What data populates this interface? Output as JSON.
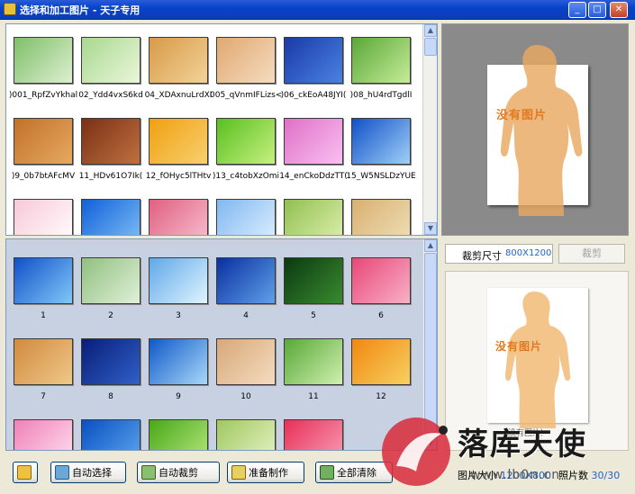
{
  "window": {
    "title": "选择和加工图片 - 天子专用",
    "buttons": [
      "minimize",
      "maximize",
      "close"
    ]
  },
  "source_list": {
    "items": [
      {
        "caption": ")001_RpfZvYkhal",
        "colors": [
          "#7FBF6A",
          "#DDEFD0"
        ]
      },
      {
        "caption": "02_Ydd4vxS6kd",
        "colors": [
          "#A8D890",
          "#EAF6DA"
        ]
      },
      {
        "caption": "04_XDAxnuLrdXI",
        "colors": [
          "#D89A48",
          "#F2D298"
        ]
      },
      {
        "caption": "005_qVnmIFLizs<",
        "colors": [
          "#E0A870",
          "#F5DCC0"
        ]
      },
      {
        "caption": ")06_ckEoA48JYI(",
        "colors": [
          "#1A3AA8",
          "#4A82E0"
        ]
      },
      {
        "caption": ")08_hU4rdTgdlI",
        "colors": [
          "#5AA838",
          "#C6EC98"
        ]
      },
      {
        "caption": ")9_0b7btAFcMV",
        "colors": [
          "#C0722A",
          "#E8A860"
        ]
      },
      {
        "caption": "11_HDv61O7Ik(",
        "colors": [
          "#7A3014",
          "#C07040"
        ]
      },
      {
        "caption": "12_fOHyc5lTHtv",
        "colors": [
          "#F0A010",
          "#F8D070"
        ]
      },
      {
        "caption": ")13_c4tobXzOmi",
        "colors": [
          "#58C020",
          "#C8F080"
        ]
      },
      {
        "caption": "14_enCkoDdzTT(",
        "colors": [
          "#E070C8",
          "#F8C0F0"
        ]
      },
      {
        "caption": "15_W5NSLDzYUE",
        "colors": [
          "#1050C8",
          "#A0D0F8"
        ]
      },
      {
        "caption": "",
        "colors": [
          "#F8C8D8",
          "#FFFFFF"
        ]
      },
      {
        "caption": "",
        "colors": [
          "#1060D8",
          "#80C0F8"
        ]
      },
      {
        "caption": "",
        "colors": [
          "#E06080",
          "#F8C0D0"
        ]
      },
      {
        "caption": "",
        "colors": [
          "#80B8F0",
          "#E0F0FF"
        ]
      },
      {
        "caption": "",
        "colors": [
          "#90C050",
          "#E0F0B0"
        ]
      },
      {
        "caption": "",
        "colors": [
          "#D8B070",
          "#F0E0B8"
        ]
      }
    ]
  },
  "selected_list": {
    "items": [
      {
        "caption": "1",
        "colors": [
          "#1050C8",
          "#80C8F8"
        ]
      },
      {
        "caption": "2",
        "colors": [
          "#90C080",
          "#E0F0D8"
        ]
      },
      {
        "caption": "3",
        "colors": [
          "#60A8E8",
          "#E0F4FF"
        ]
      },
      {
        "caption": "4",
        "colors": [
          "#0830A0",
          "#60A0E8"
        ]
      },
      {
        "caption": "5",
        "colors": [
          "#0A3A10",
          "#3A8A30"
        ]
      },
      {
        "caption": "6",
        "colors": [
          "#E84878",
          "#F8B0C8"
        ]
      },
      {
        "caption": "7",
        "colors": [
          "#D08A40",
          "#F0C888"
        ]
      },
      {
        "caption": "8",
        "colors": [
          "#081E78",
          "#3060C8"
        ]
      },
      {
        "caption": "9",
        "colors": [
          "#1058C8",
          "#A8D8F8"
        ]
      },
      {
        "caption": "10",
        "colors": [
          "#D8A878",
          "#F4DCC0"
        ]
      },
      {
        "caption": "11",
        "colors": [
          "#58A838",
          "#D0F0B0"
        ]
      },
      {
        "caption": "12",
        "colors": [
          "#F08810",
          "#F8D060"
        ]
      },
      {
        "caption": "",
        "colors": [
          "#F080B8",
          "#FFE0F0"
        ]
      },
      {
        "caption": "",
        "colors": [
          "#0850C0",
          "#60A8F0"
        ]
      },
      {
        "caption": "",
        "colors": [
          "#48A818",
          "#B8E880"
        ]
      },
      {
        "caption": "",
        "colors": [
          "#A0C860",
          "#E8F4C8"
        ]
      },
      {
        "caption": "",
        "colors": [
          "#E83058",
          "#F8A0B8"
        ]
      }
    ]
  },
  "preview": {
    "placeholder_text": "没有图片",
    "small_caption": "（没有图片）",
    "crop_size_label": "裁剪尺寸",
    "crop_size_value": "800X1200",
    "crop_button": "裁剪"
  },
  "toolbar": {
    "auto_select": "自动选择",
    "auto_crop": "自动裁剪",
    "prepare": "准备制作",
    "clear_all": "全部清除",
    "image_size_label": "图片大小",
    "image_size_value": "1200X800",
    "count_label": "照片数",
    "count_value": "30/30"
  },
  "watermark": {
    "text": "落库天使",
    "url": "www.lb0n.cn"
  },
  "colors": {
    "title_bar": "#0843C9",
    "list_bg_selected": "#C7D1E1",
    "accent_blue": "#1F63C6",
    "placeholder_orange": "#E07A20"
  }
}
